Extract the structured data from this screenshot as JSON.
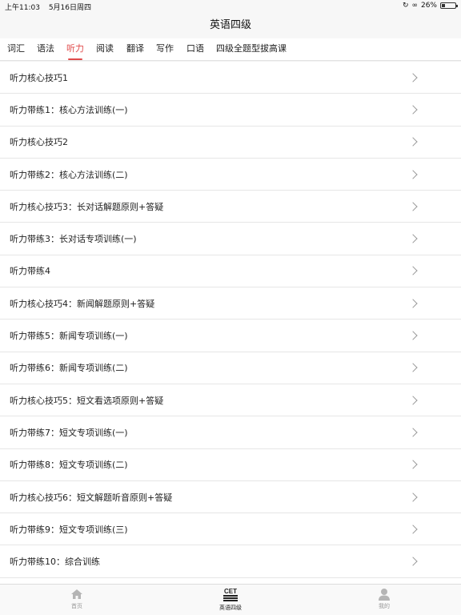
{
  "status_bar": {
    "time": "上午11:03",
    "date": "5月16日周四",
    "battery": "26%",
    "battery_level": 0.26
  },
  "nav": {
    "title": "英语四级"
  },
  "tabs": [
    {
      "label": "词汇"
    },
    {
      "label": "语法"
    },
    {
      "label": "听力",
      "active": true
    },
    {
      "label": "阅读"
    },
    {
      "label": "翻译"
    },
    {
      "label": "写作"
    },
    {
      "label": "口语"
    },
    {
      "label": "四级全题型拔高课"
    }
  ],
  "list": {
    "items": [
      "听力核心技巧1",
      "听力带练1：核心方法训练(一)",
      "听力核心技巧2",
      "听力带练2：核心方法训练(二)",
      "听力核心技巧3：长对话解题原则+答疑",
      "听力带练3：长对话专项训练(一)",
      "听力带练4",
      "听力核心技巧4：新闻解题原则+答疑",
      "听力带练5：新闻专项训练(一)",
      "听力带练6：新闻专项训练(二)",
      "听力核心技巧5：短文看选项原则+答疑",
      "听力带练7：短文专项训练(一)",
      "听力带练8：短文专项训练(二)",
      "听力核心技巧6：短文解题听音原则+答疑",
      "听力带练9：短文专项训练(三)",
      "听力带练10：综合训练"
    ]
  },
  "tab_bar": {
    "home_label": "首页",
    "cet_icon_text": "CET",
    "cet_label": "英语四级",
    "me_label": "我的"
  },
  "colors": {
    "accent": "#e04a4a"
  }
}
